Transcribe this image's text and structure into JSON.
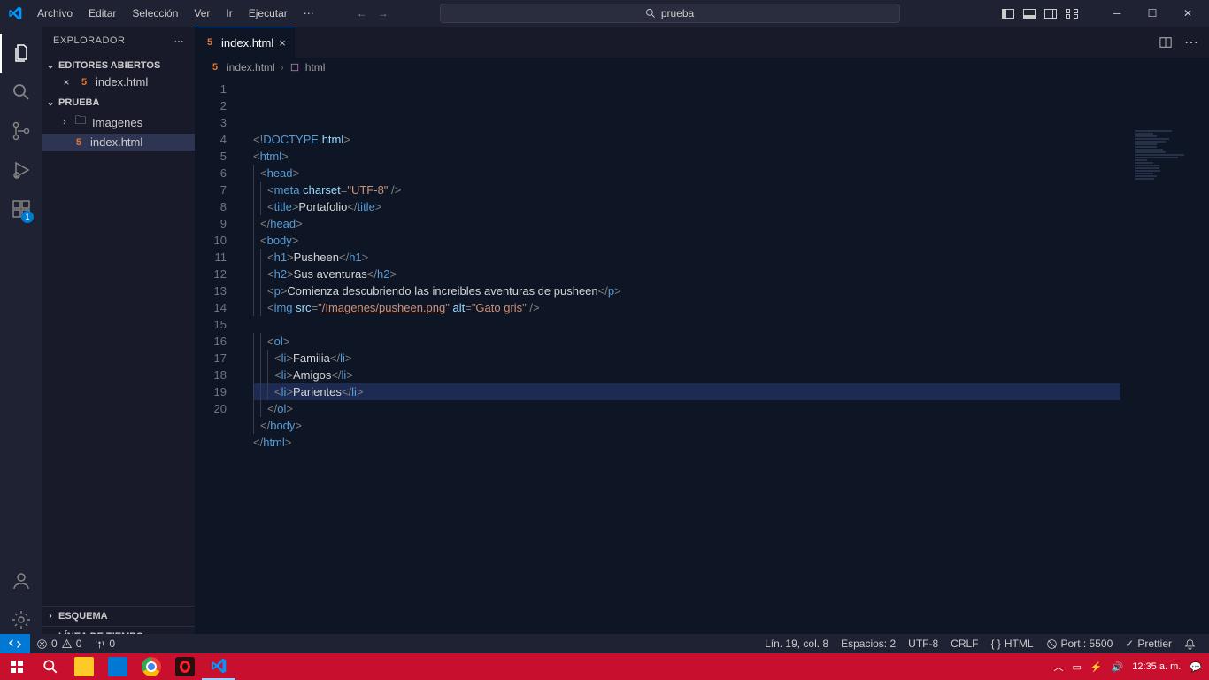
{
  "titlebar": {
    "menu": [
      "Archivo",
      "Editar",
      "Selección",
      "Ver",
      "Ir",
      "Ejecutar"
    ],
    "more": "⋯",
    "search": "prueba"
  },
  "sidebar": {
    "title": "EXPLORADOR",
    "sections": {
      "open_editors": {
        "label": "EDITORES ABIERTOS",
        "items": [
          {
            "name": "index.html"
          }
        ]
      },
      "project": {
        "label": "PRUEBA",
        "items": [
          {
            "name": "Imagenes",
            "type": "folder"
          },
          {
            "name": "index.html",
            "type": "file",
            "selected": true
          }
        ]
      },
      "outline": {
        "label": "ESQUEMA"
      },
      "timeline": {
        "label": "LÍNEA DE TIEMPO"
      }
    }
  },
  "tabs": {
    "active": "index.html"
  },
  "breadcrumb": {
    "file": "index.html",
    "symbol": "html"
  },
  "code": {
    "lines": [
      {
        "n": 1,
        "indent": 0,
        "tokens": [
          [
            "punct",
            "<!"
          ],
          [
            "doctype",
            "DOCTYPE"
          ],
          [
            "text",
            " "
          ],
          [
            "attr",
            "html"
          ],
          [
            "punct",
            ">"
          ]
        ]
      },
      {
        "n": 2,
        "indent": 0,
        "tokens": [
          [
            "punct",
            "<"
          ],
          [
            "tag",
            "html"
          ],
          [
            "punct",
            ">"
          ]
        ]
      },
      {
        "n": 3,
        "indent": 1,
        "tokens": [
          [
            "punct",
            "<"
          ],
          [
            "tag",
            "head"
          ],
          [
            "punct",
            ">"
          ]
        ]
      },
      {
        "n": 4,
        "indent": 2,
        "tokens": [
          [
            "punct",
            "<"
          ],
          [
            "tag",
            "meta"
          ],
          [
            "text",
            " "
          ],
          [
            "attr",
            "charset"
          ],
          [
            "punct",
            "="
          ],
          [
            "str",
            "\"UTF-8\""
          ],
          [
            "text",
            " "
          ],
          [
            "punct",
            "/>"
          ]
        ]
      },
      {
        "n": 5,
        "indent": 2,
        "tokens": [
          [
            "punct",
            "<"
          ],
          [
            "tag",
            "title"
          ],
          [
            "punct",
            ">"
          ],
          [
            "text",
            "Portafolio"
          ],
          [
            "punct",
            "</"
          ],
          [
            "tag",
            "title"
          ],
          [
            "punct",
            ">"
          ]
        ]
      },
      {
        "n": 6,
        "indent": 1,
        "tokens": [
          [
            "punct",
            "</"
          ],
          [
            "tag",
            "head"
          ],
          [
            "punct",
            ">"
          ]
        ]
      },
      {
        "n": 7,
        "indent": 1,
        "tokens": [
          [
            "punct",
            "<"
          ],
          [
            "tag",
            "body"
          ],
          [
            "punct",
            ">"
          ]
        ]
      },
      {
        "n": 8,
        "indent": 2,
        "tokens": [
          [
            "punct",
            "<"
          ],
          [
            "tag",
            "h1"
          ],
          [
            "punct",
            ">"
          ],
          [
            "text",
            "Pusheen"
          ],
          [
            "punct",
            "</"
          ],
          [
            "tag",
            "h1"
          ],
          [
            "punct",
            ">"
          ]
        ]
      },
      {
        "n": 9,
        "indent": 2,
        "tokens": [
          [
            "punct",
            "<"
          ],
          [
            "tag",
            "h2"
          ],
          [
            "punct",
            ">"
          ],
          [
            "text",
            "Sus aventuras"
          ],
          [
            "punct",
            "</"
          ],
          [
            "tag",
            "h2"
          ],
          [
            "punct",
            ">"
          ]
        ]
      },
      {
        "n": 10,
        "indent": 2,
        "tokens": [
          [
            "punct",
            "<"
          ],
          [
            "tag",
            "p"
          ],
          [
            "punct",
            ">"
          ],
          [
            "text",
            "Comienza descubriendo las increibles aventuras de pusheen"
          ],
          [
            "punct",
            "</"
          ],
          [
            "tag",
            "p"
          ],
          [
            "punct",
            ">"
          ]
        ]
      },
      {
        "n": 11,
        "indent": 2,
        "tokens": [
          [
            "punct",
            "<"
          ],
          [
            "tag",
            "img"
          ],
          [
            "text",
            " "
          ],
          [
            "attr",
            "src"
          ],
          [
            "punct",
            "="
          ],
          [
            "str",
            "\""
          ],
          [
            "link",
            "/Imagenes/pusheen.png"
          ],
          [
            "str",
            "\""
          ],
          [
            "text",
            " "
          ],
          [
            "attr",
            "alt"
          ],
          [
            "punct",
            "="
          ],
          [
            "str",
            "\"Gato gris\""
          ],
          [
            "text",
            " "
          ],
          [
            "punct",
            "/>"
          ]
        ]
      },
      {
        "n": 12,
        "indent": 0,
        "tokens": []
      },
      {
        "n": 13,
        "indent": 2,
        "tokens": [
          [
            "punct",
            "<"
          ],
          [
            "tag",
            "ol"
          ],
          [
            "punct",
            ">"
          ]
        ]
      },
      {
        "n": 14,
        "indent": 3,
        "tokens": [
          [
            "punct",
            "<"
          ],
          [
            "tag",
            "li"
          ],
          [
            "punct",
            ">"
          ],
          [
            "text",
            "Familia"
          ],
          [
            "punct",
            "</"
          ],
          [
            "tag",
            "li"
          ],
          [
            "punct",
            ">"
          ]
        ]
      },
      {
        "n": 15,
        "indent": 3,
        "tokens": [
          [
            "punct",
            "<"
          ],
          [
            "tag",
            "li"
          ],
          [
            "punct",
            ">"
          ],
          [
            "text",
            "Amigos"
          ],
          [
            "punct",
            "</"
          ],
          [
            "tag",
            "li"
          ],
          [
            "punct",
            ">"
          ]
        ]
      },
      {
        "n": 16,
        "indent": 3,
        "tokens": [
          [
            "punct",
            "<"
          ],
          [
            "tag",
            "li"
          ],
          [
            "punct",
            ">"
          ],
          [
            "text",
            "Parientes"
          ],
          [
            "punct",
            "</"
          ],
          [
            "tag",
            "li"
          ],
          [
            "punct",
            ">"
          ]
        ]
      },
      {
        "n": 17,
        "indent": 2,
        "tokens": [
          [
            "punct",
            "</"
          ],
          [
            "tag",
            "ol"
          ],
          [
            "punct",
            ">"
          ]
        ]
      },
      {
        "n": 18,
        "indent": 1,
        "tokens": [
          [
            "punct",
            "</"
          ],
          [
            "tag",
            "body"
          ],
          [
            "punct",
            ">"
          ]
        ]
      },
      {
        "n": 19,
        "indent": 0,
        "tokens": [
          [
            "punct",
            "</"
          ],
          [
            "tag",
            "html"
          ],
          [
            "punct",
            ">"
          ]
        ],
        "highlighted": true
      },
      {
        "n": 20,
        "indent": 0,
        "tokens": []
      }
    ]
  },
  "statusbar": {
    "errors": "0",
    "warnings": "0",
    "port_err": "0",
    "cursor": "Lín. 19, col. 8",
    "spaces": "Espacios: 2",
    "encoding": "UTF-8",
    "eol": "CRLF",
    "lang_icon": "{ }",
    "lang": "HTML",
    "port": "Port : 5500",
    "prettier": "Prettier"
  },
  "taskbar": {
    "time": "12:35 a. m."
  },
  "activitybar": {
    "ext_badge": "1"
  }
}
